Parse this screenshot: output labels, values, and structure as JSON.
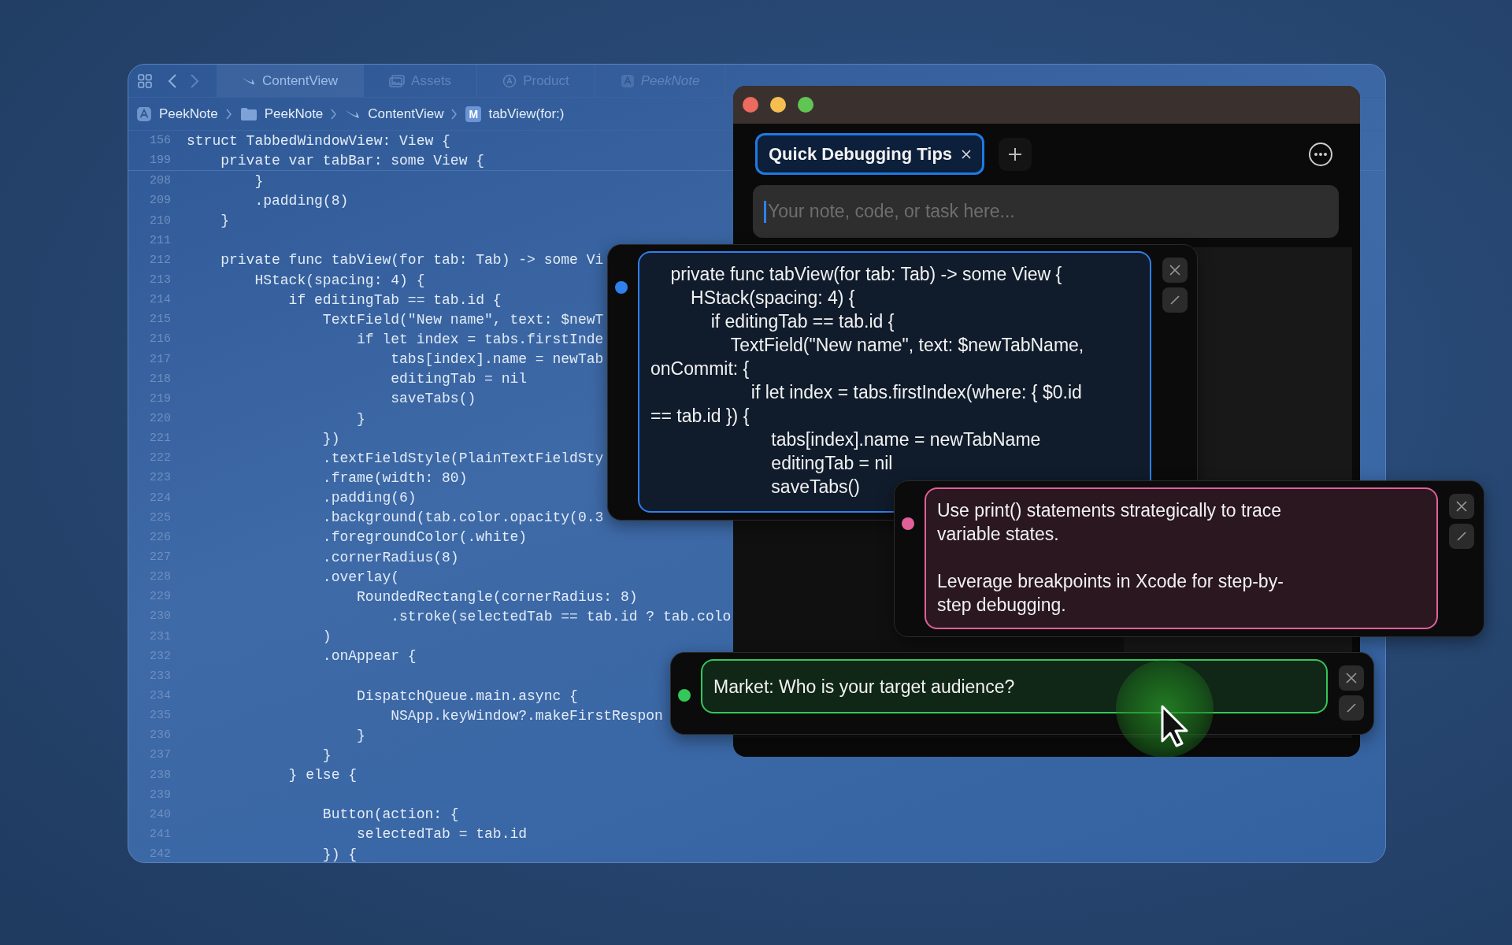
{
  "editor": {
    "tabs": [
      {
        "label": "ContentView",
        "selected": true,
        "preview": false
      },
      {
        "label": "Assets",
        "selected": false,
        "preview": false
      },
      {
        "label": "Product",
        "selected": false,
        "preview": false
      },
      {
        "label": "PeekNote",
        "selected": false,
        "preview": true
      }
    ],
    "breadcrumb": [
      {
        "label": "PeekNote"
      },
      {
        "label": "PeekNote"
      },
      {
        "label": "ContentView"
      },
      {
        "label": "tabView(for:)",
        "badge": "M"
      }
    ],
    "header_lines": [
      {
        "number": "156",
        "code": "struct TabbedWindowView: View {"
      },
      {
        "number": "199",
        "code": "    private var tabBar: some View {"
      }
    ],
    "lines": [
      {
        "number": "208",
        "code": "        }"
      },
      {
        "number": "209",
        "code": "        .padding(8)"
      },
      {
        "number": "210",
        "code": "    }"
      },
      {
        "number": "211"
      },
      {
        "number": "212",
        "code": "    private func tabView(for tab: Tab) -> some Vi"
      },
      {
        "number": "213",
        "code": "        HStack(spacing: 4) {"
      },
      {
        "number": "214",
        "code": "            if editingTab == tab.id {"
      },
      {
        "number": "215",
        "code": "                TextField(\"New name\", text: $newT"
      },
      {
        "number": "216",
        "code": "                    if let index = tabs.firstInde"
      },
      {
        "number": "217",
        "code": "                        tabs[index].name = newTab"
      },
      {
        "number": "218",
        "code": "                        editingTab = nil"
      },
      {
        "number": "219",
        "code": "                        saveTabs()"
      },
      {
        "number": "220",
        "code": "                    }"
      },
      {
        "number": "221",
        "code": "                })"
      },
      {
        "number": "222",
        "code": "                .textFieldStyle(PlainTextFieldSty"
      },
      {
        "number": "223",
        "code": "                .frame(width: 80)"
      },
      {
        "number": "224",
        "code": "                .padding(6)"
      },
      {
        "number": "225",
        "code": "                .background(tab.color.opacity(0.3"
      },
      {
        "number": "226",
        "code": "                .foregroundColor(.white)"
      },
      {
        "number": "227",
        "code": "                .cornerRadius(8)"
      },
      {
        "number": "228",
        "code": "                .overlay("
      },
      {
        "number": "229",
        "code": "                    RoundedRectangle(cornerRadius: 8)"
      },
      {
        "number": "230",
        "code": "                        .stroke(selectedTab == tab.id ? tab.colo"
      },
      {
        "number": "231",
        "code": "                )"
      },
      {
        "number": "232",
        "code": "                .onAppear {"
      },
      {
        "number": "233"
      },
      {
        "number": "234",
        "code": "                    DispatchQueue.main.async {"
      },
      {
        "number": "235",
        "code": "                        NSApp.keyWindow?.makeFirstRespon"
      },
      {
        "number": "236",
        "code": "                    }"
      },
      {
        "number": "237",
        "code": "                }"
      },
      {
        "number": "238",
        "code": "            } else {"
      },
      {
        "number": "239"
      },
      {
        "number": "240",
        "code": "                Button(action: {"
      },
      {
        "number": "241",
        "code": "                    selectedTab = tab.id"
      },
      {
        "number": "242",
        "code": "                }) {"
      }
    ]
  },
  "notes_window": {
    "tabs": [
      {
        "label": "Quick Debugging Tips",
        "selected": true
      }
    ],
    "input": {
      "placeholder": "Your note, code, or task here..."
    }
  },
  "notes": [
    {
      "color": "#2f80ed",
      "text": "    private func tabView(for tab: Tab) -> some View {\n        HStack(spacing: 4) {\n            if editingTab == tab.id {\n                TextField(\"New name\", text: $newTabName,\nonCommit: {\n                    if let index = tabs.firstIndex(where: { $0.id\n== tab.id }) {\n                        tabs[index].name = newTabName\n                        editingTab = nil\n                        saveTabs()"
    },
    {
      "color": "#e2609a",
      "text": "Use print() statements strategically to trace\nvariable states.\n\nLeverage breakpoints in Xcode for step-by-\nstep debugging."
    },
    {
      "color": "#34c759",
      "text": "Market: Who is your target audience?"
    }
  ]
}
